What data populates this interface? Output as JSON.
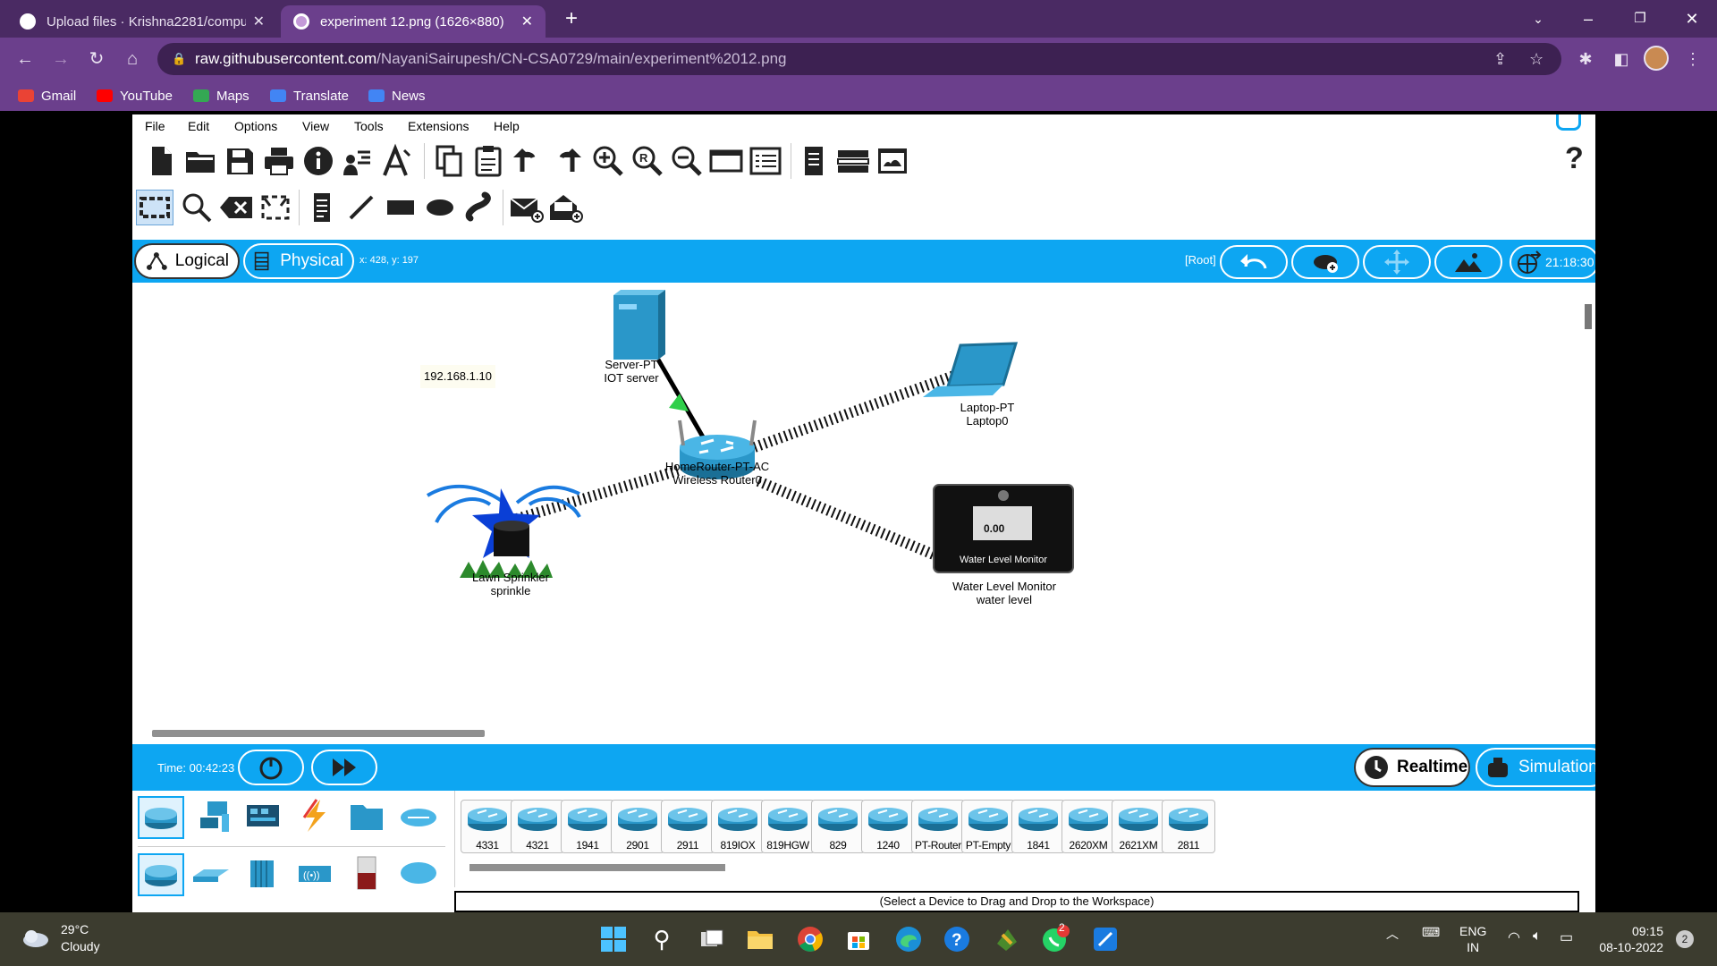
{
  "browser": {
    "tabs": [
      {
        "title": "Upload files · Krishna2281/compu",
        "active": false,
        "icon": "github-icon"
      },
      {
        "title": "experiment 12.png (1626×880)",
        "active": true,
        "icon": "image-icon"
      }
    ],
    "url_host": "raw.githubusercontent.com",
    "url_path": "/NayaniSairupesh/CN-CSA0729/main/experiment%2012.png",
    "bookmarks": [
      {
        "label": "Gmail",
        "icon": "gmail-icon",
        "color": "#ea4335"
      },
      {
        "label": "YouTube",
        "icon": "youtube-icon",
        "color": "#ff0000"
      },
      {
        "label": "Maps",
        "icon": "maps-icon",
        "color": "#34a853"
      },
      {
        "label": "Translate",
        "icon": "translate-icon",
        "color": "#4285f4"
      },
      {
        "label": "News",
        "icon": "news-icon",
        "color": "#4285f4"
      }
    ]
  },
  "pt": {
    "menu": [
      "File",
      "Edit",
      "Options",
      "View",
      "Tools",
      "Extensions",
      "Help"
    ],
    "help_glyph": "?",
    "modebar": {
      "logical": "Logical",
      "physical": "Physical",
      "coords": "x: 428, y: 197",
      "root": "[Root]",
      "clock": "21:18:30"
    },
    "workspace": {
      "server": {
        "line1": "Server-PT",
        "line2": "IOT server",
        "ip": "192.168.1.10"
      },
      "router": {
        "line1": "HomeRouter-PT-AC",
        "line2": "Wireless Router0"
      },
      "laptop": {
        "line1": "Laptop-PT",
        "line2": "Laptop0"
      },
      "sprinkler": {
        "line1": "Lawn Sprinkler",
        "line2": "sprinkle"
      },
      "monitor": {
        "line1": "Water Level Monitor",
        "line2": "water level",
        "screen_value": "0.00",
        "screen_label": "Water Level Monitor"
      }
    },
    "simbar": {
      "time": "Time: 00:42:23",
      "realtime": "Realtime",
      "simulation": "Simulation"
    },
    "models": [
      "4331",
      "4321",
      "1941",
      "2901",
      "2911",
      "819IOX",
      "819HGW",
      "829",
      "1240",
      "PT-Router",
      "PT-Empty",
      "1841",
      "2620XM",
      "2621XM",
      "2811"
    ],
    "status": "(Select a Device to Drag and Drop to the Workspace)"
  },
  "taskbar": {
    "temp": "29°C",
    "weather": "Cloudy",
    "lang1": "ENG",
    "lang2": "IN",
    "time": "09:15",
    "date": "08-10-2022",
    "notifications": "2",
    "whatsapp_badge": "2"
  },
  "colors": {
    "chrome_dark": "#4a2a63",
    "chrome": "#6b3f8c",
    "pt_blue": "#0da6f2",
    "taskbar": "#3c3c2f"
  }
}
